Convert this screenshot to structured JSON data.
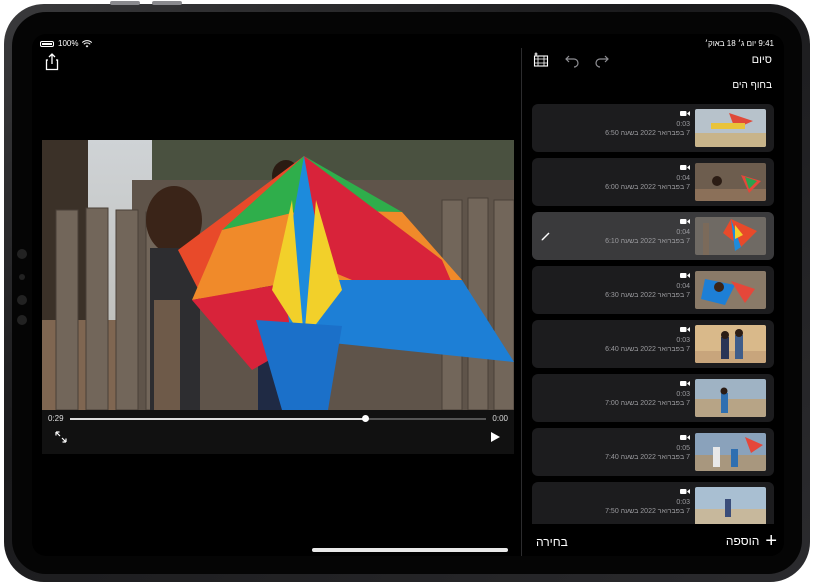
{
  "status": {
    "battery": "100%",
    "wifi_icon": "wifi-icon",
    "datetime": "9:41  יום ג׳ 18 באוק׳"
  },
  "toolbar": {
    "share_icon": "share-icon",
    "add_clip_icon": "film-add-icon",
    "undo_icon": "undo-icon",
    "redo_icon": "redo-icon",
    "done_label": "סיום"
  },
  "viewer": {
    "elapsed": "0:29",
    "remaining": "0:00",
    "progress_fraction": 0.71,
    "expand_icon": "expand-icon",
    "play_icon": "play-icon"
  },
  "library": {
    "section_title": "בחוף הים",
    "clips": [
      {
        "duration": "0:03",
        "date": "7 בפברואר 2022 בשעה 6:50",
        "selected": false
      },
      {
        "duration": "0:04",
        "date": "7 בפברואר 2022 בשעה 6:00",
        "selected": false
      },
      {
        "duration": "0:04",
        "date": "7 בפברואר 2022 בשעה 6:10",
        "selected": true
      },
      {
        "duration": "0:04",
        "date": "7 בפברואר 2022 בשעה 6:30",
        "selected": false
      },
      {
        "duration": "0:03",
        "date": "7 בפברואר 2022 בשעה 6:40",
        "selected": false
      },
      {
        "duration": "0:03",
        "date": "7 בפברואר 2022 בשעה 7:00",
        "selected": false
      },
      {
        "duration": "0:05",
        "date": "7 בפברואר 2022 בשעה 7:40",
        "selected": false
      },
      {
        "duration": "0:03",
        "date": "7 בפברואר 2022 בשעה 7:50",
        "selected": false
      }
    ]
  },
  "bottom": {
    "select_label": "בחירה",
    "add_label": "הוספה"
  },
  "colors": {
    "background": "#000000",
    "panel_row": "#1c1c1e",
    "panel_row_selected": "#3a3a3c",
    "text_secondary": "#9a9a9e"
  }
}
